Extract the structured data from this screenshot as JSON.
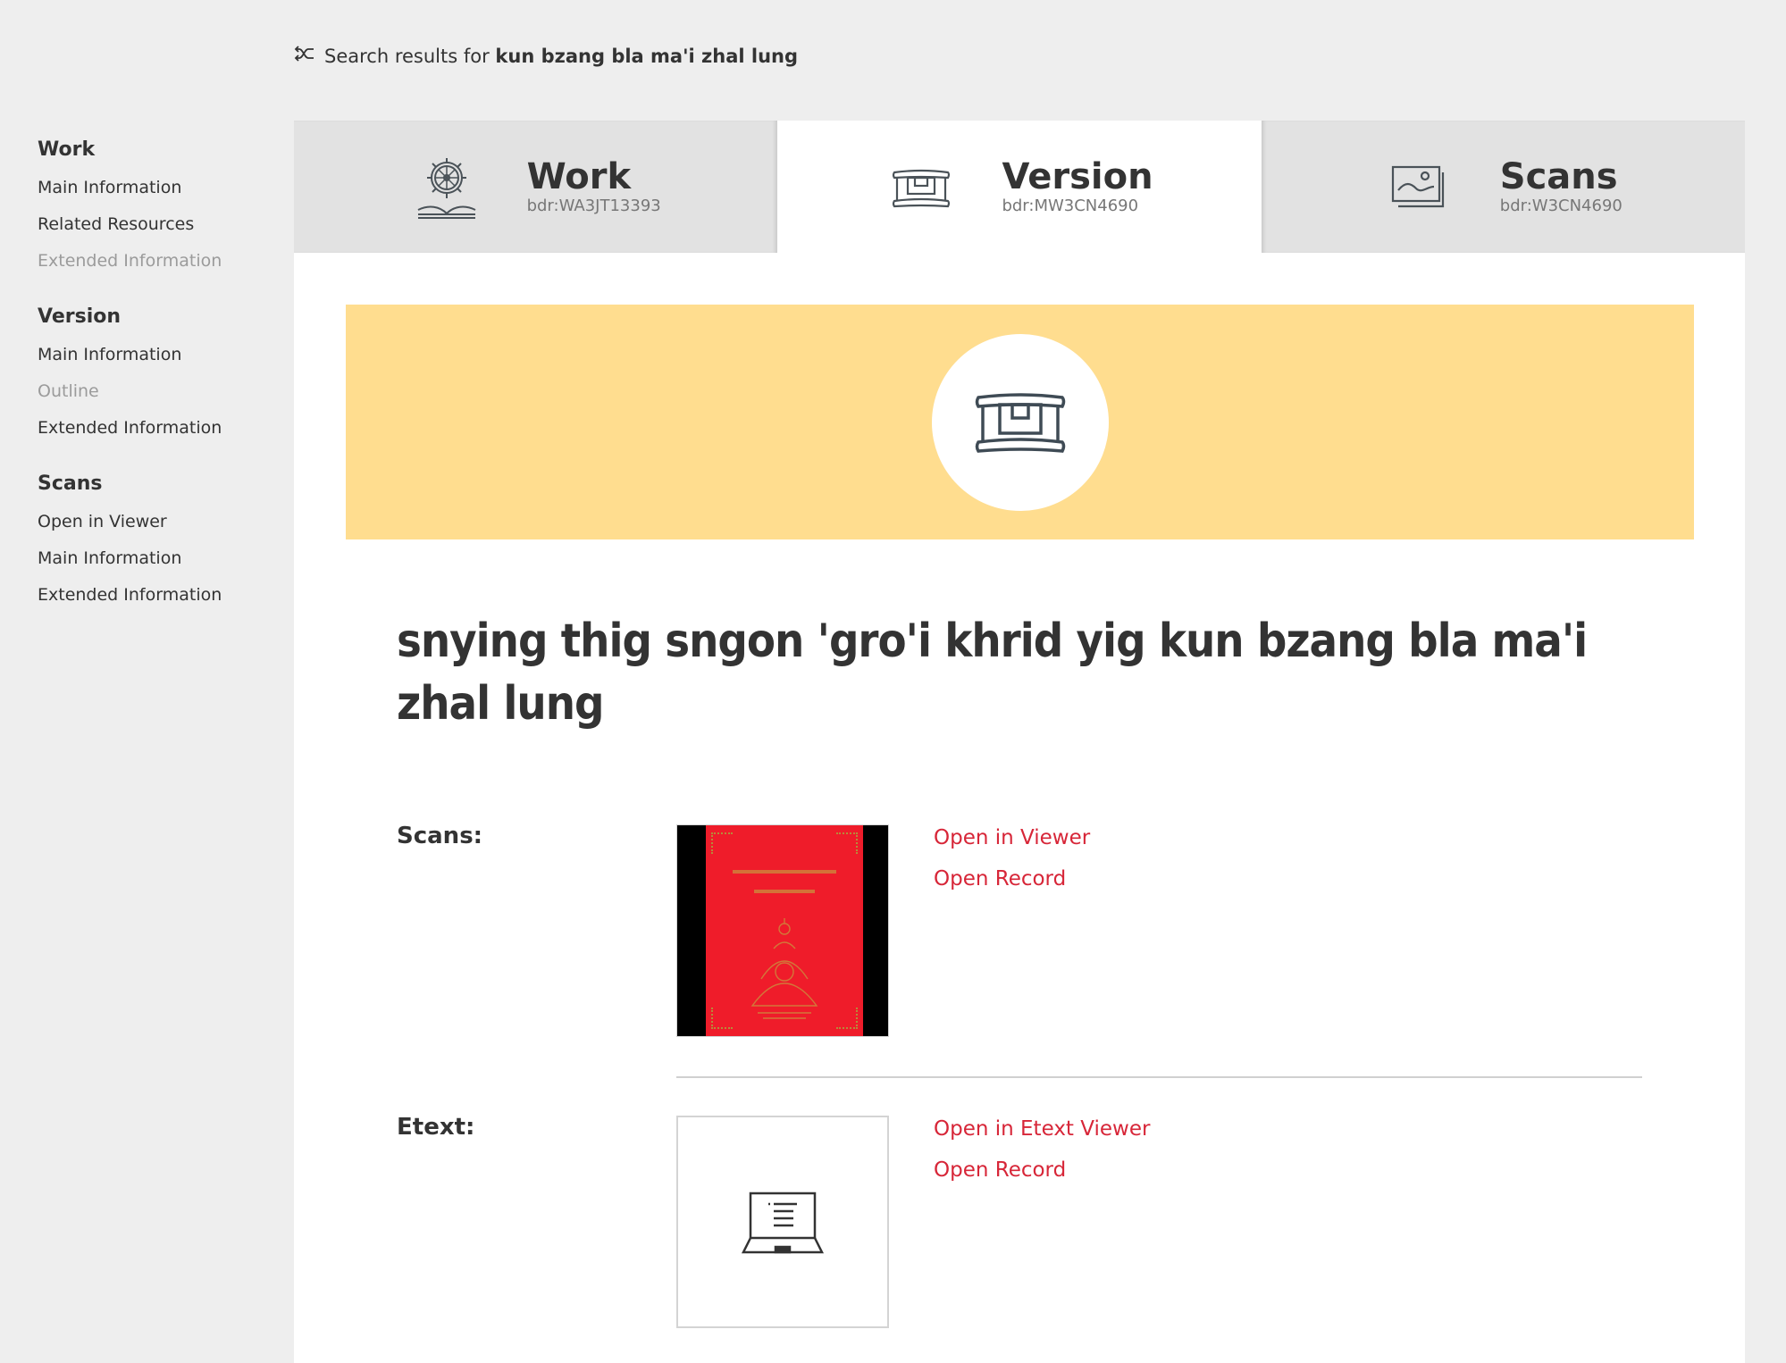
{
  "search": {
    "prefix": "Search results for",
    "query": "kun bzang bla ma'i zhal lung",
    "icon": "shuffle-arrows-icon"
  },
  "sidebar": {
    "groups": [
      {
        "heading": "Work",
        "items": [
          {
            "label": "Main Information",
            "enabled": true
          },
          {
            "label": "Related Resources",
            "enabled": true
          },
          {
            "label": "Extended Information",
            "enabled": false
          }
        ]
      },
      {
        "heading": "Version",
        "items": [
          {
            "label": "Main Information",
            "enabled": true
          },
          {
            "label": "Outline",
            "enabled": false
          },
          {
            "label": "Extended Information",
            "enabled": true
          }
        ]
      },
      {
        "heading": "Scans",
        "items": [
          {
            "label": "Open in Viewer",
            "enabled": true
          },
          {
            "label": "Main Information",
            "enabled": true
          },
          {
            "label": "Extended Information",
            "enabled": true
          }
        ]
      }
    ]
  },
  "tabs": [
    {
      "title": "Work",
      "id": "bdr:WA3JT13393",
      "icon": "dharma-wheel-book-icon",
      "active": false
    },
    {
      "title": "Version",
      "id": "bdr:MW3CN4690",
      "icon": "pecha-box-icon",
      "active": true
    },
    {
      "title": "Scans",
      "id": "bdr:W3CN4690",
      "icon": "images-icon",
      "active": false
    }
  ],
  "banner": {
    "icon": "pecha-box-icon",
    "color": "#ffdd8f"
  },
  "title": "snying thig sngon 'gro'i khrid yig kun bzang bla ma'i zhal lung",
  "sections": {
    "scans": {
      "label": "Scans:",
      "thumbnail": "red-book-cover-image",
      "links": [
        "Open in Viewer",
        "Open Record"
      ]
    },
    "etext": {
      "label": "Etext:",
      "thumbnail": "laptop-text-icon",
      "links": [
        "Open in Etext Viewer",
        "Open Record"
      ]
    }
  },
  "colors": {
    "accent_link": "#d72638",
    "background": "#eeeeee",
    "tab_inactive": "#e2e2e2",
    "banner": "#ffdd8f"
  }
}
